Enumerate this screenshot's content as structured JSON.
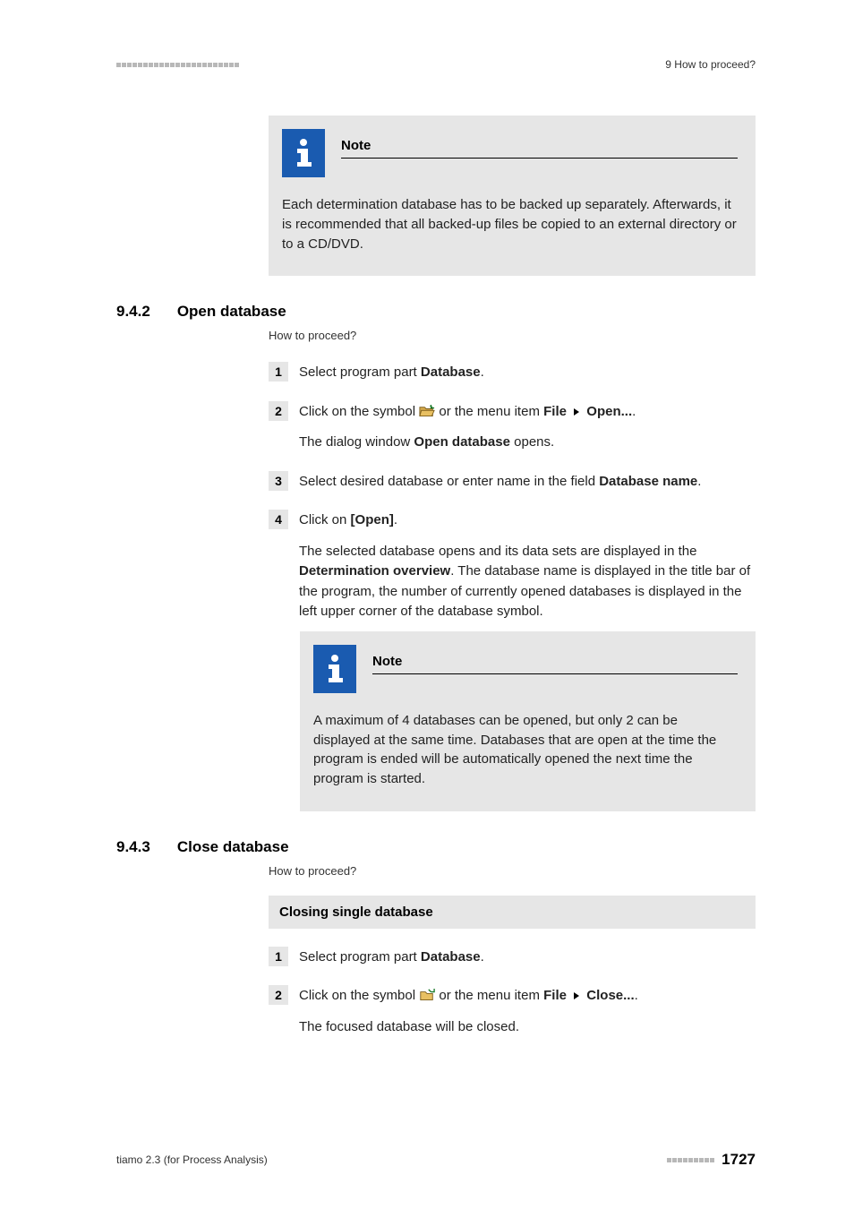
{
  "header": {
    "right": "9 How to proceed?"
  },
  "notes": {
    "label": "Note",
    "note1_body": "Each determination database has to be backed up separately. Afterwards, it is recommended that all backed-up files be copied to an external directory or to a CD/DVD.",
    "note2_body": "A maximum of 4 databases can be opened, but only 2 can be displayed at the same time. Databases that are open at the time the program is ended will be automatically opened the next time the program is started."
  },
  "section_942": {
    "number": "9.4.2",
    "title": "Open database",
    "subsec": "How to proceed?",
    "step1": {
      "num": "1",
      "text_pre": "Select program part ",
      "bold": "Database",
      "text_post": "."
    },
    "step2": {
      "num": "2",
      "line1_pre": "Click on the symbol ",
      "line1_mid": " or the menu item ",
      "file": "File",
      "open": "Open...",
      "line2_pre": "The dialog window ",
      "line2_bold": "Open database",
      "line2_post": " opens."
    },
    "step3": {
      "num": "3",
      "text_pre": "Select desired database or enter name in the field ",
      "bold": "Database name",
      "text_post": "."
    },
    "step4": {
      "num": "4",
      "line1_pre": "Click on ",
      "line1_bold": "[Open]",
      "line1_post": ".",
      "line2_pre": "The selected database opens and its data sets are displayed in the ",
      "line2_bold": "Determination overview",
      "line2_post": ". The database name is displayed in the title bar of the program, the number of currently opened databases is displayed in the left upper corner of the database symbol."
    }
  },
  "section_943": {
    "number": "9.4.3",
    "title": "Close database",
    "subsec": "How to proceed?",
    "closing_title": "Closing single database",
    "step1": {
      "num": "1",
      "text_pre": "Select program part ",
      "bold": "Database",
      "text_post": "."
    },
    "step2": {
      "num": "2",
      "line1_pre": "Click on the symbol ",
      "line1_mid": " or the menu item ",
      "file": "File",
      "close": "Close...",
      "line2": "The focused database will be closed."
    }
  },
  "footer": {
    "left": "tiamo 2.3 (for Process Analysis)",
    "page": "1727"
  }
}
